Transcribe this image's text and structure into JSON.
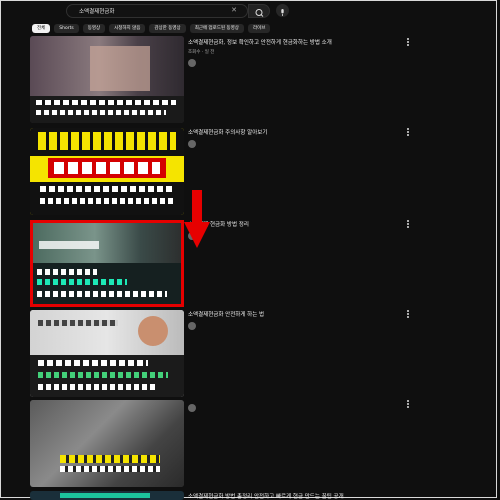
{
  "search": {
    "query": "소액결제현금화",
    "clear_icon": "close-icon",
    "button_icon": "search-icon",
    "mic_icon": "mic-icon"
  },
  "chips": [
    "전체",
    "Shorts",
    "동영상",
    "시청하지 않음",
    "감상한 동영상",
    "최근에 업로드된 동영상",
    "라이브"
  ],
  "results": [
    {
      "title": "소액결제현금화, 정보 확인하고 안전하게 현금화하는 방법 소개",
      "meta": "조회수 · 일 전",
      "channel": "",
      "description": ""
    },
    {
      "title": "소액결제현금화 주의사항 알아보기",
      "meta": "",
      "channel": "",
      "description": ""
    },
    {
      "title": "소액결제 현금화 방법 정리",
      "meta": "",
      "channel": "",
      "description": ""
    },
    {
      "title": "소액결제현금화 안전하게 하는 법",
      "meta": "",
      "channel": "",
      "description": ""
    },
    {
      "title": "",
      "meta": "",
      "channel": "",
      "description": ""
    },
    {
      "title": "소액결제현금화 방법 총정리 안전하고 빠르게 현금 만드는 꿀팁 공개",
      "meta": "",
      "channel": "",
      "description": ""
    }
  ],
  "annotation": {
    "arrow_color": "#e60000",
    "highlight_border_color": "#e60000"
  },
  "colors": {
    "background": "#0f0f0f",
    "thumb_yellow": "#f5e400",
    "thumb_red": "#d40000"
  }
}
